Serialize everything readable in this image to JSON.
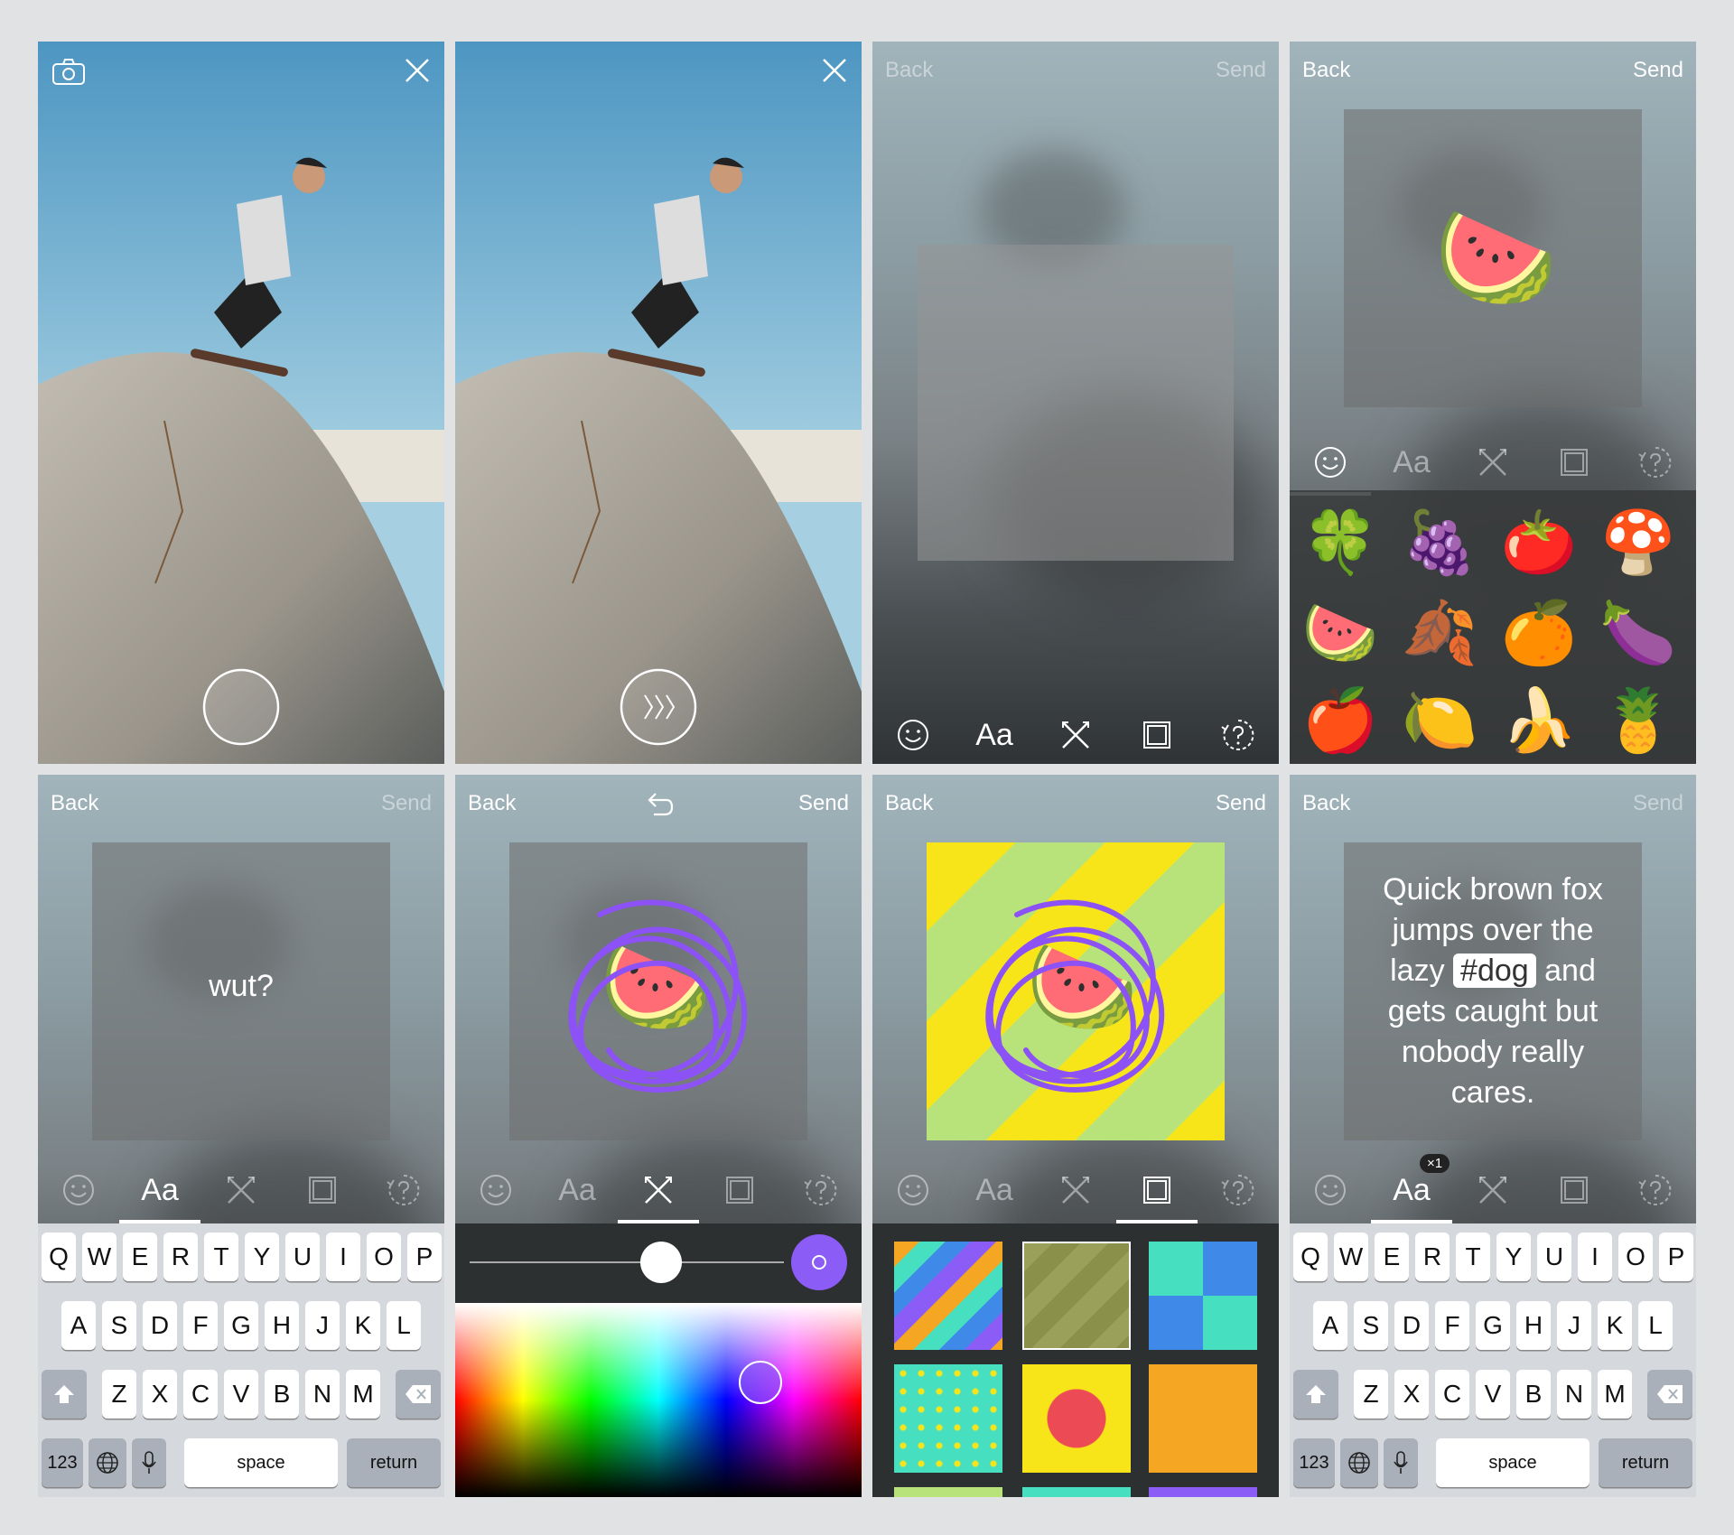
{
  "nav": {
    "back": "Back",
    "send": "Send"
  },
  "toolbar": {
    "text_tool": "Aa",
    "text_badge": "×1"
  },
  "panel5": {
    "caption": "wut?"
  },
  "panel8": {
    "caption_line1": "Quick brown fox",
    "caption_line2": "jumps over the",
    "caption_lazy": "lazy",
    "caption_hashtag": "#dog",
    "caption_and": "and",
    "caption_line4": "gets caught but",
    "caption_line5": "nobody really",
    "caption_line6": "cares."
  },
  "keyboard": {
    "row1": [
      "Q",
      "W",
      "E",
      "R",
      "T",
      "Y",
      "U",
      "I",
      "O",
      "P"
    ],
    "row2": [
      "A",
      "S",
      "D",
      "F",
      "G",
      "H",
      "J",
      "K",
      "L"
    ],
    "row3": [
      "Z",
      "X",
      "C",
      "V",
      "B",
      "N",
      "M"
    ],
    "num_key": "123",
    "space_key": "space",
    "return_key": "return"
  },
  "emojis": [
    "🍀",
    "🍇",
    "🍅",
    "🍄",
    "🍉",
    "🍂",
    "🍊",
    "🍆",
    "🍎",
    "🍋",
    "🍌",
    "🍍"
  ],
  "sticker_emoji": "🍉",
  "colors": {
    "accent_purple": "#8b5cf6",
    "scribble_purple": "#8c52f5",
    "tile_orange": "#f5a623",
    "tile_yellow": "#f7e51a",
    "tile_red": "#ec4b55",
    "tile_teal": "#46e0c0",
    "tile_blue": "#3f8ae8"
  },
  "icons": [
    "camera-flip-icon",
    "close-icon",
    "shutter-icon",
    "next-arrows-icon",
    "smiley-icon",
    "pen-tool-icon",
    "frame-icon",
    "help-icon",
    "undo-icon",
    "shift-icon",
    "delete-icon",
    "globe-icon",
    "microphone-icon"
  ]
}
